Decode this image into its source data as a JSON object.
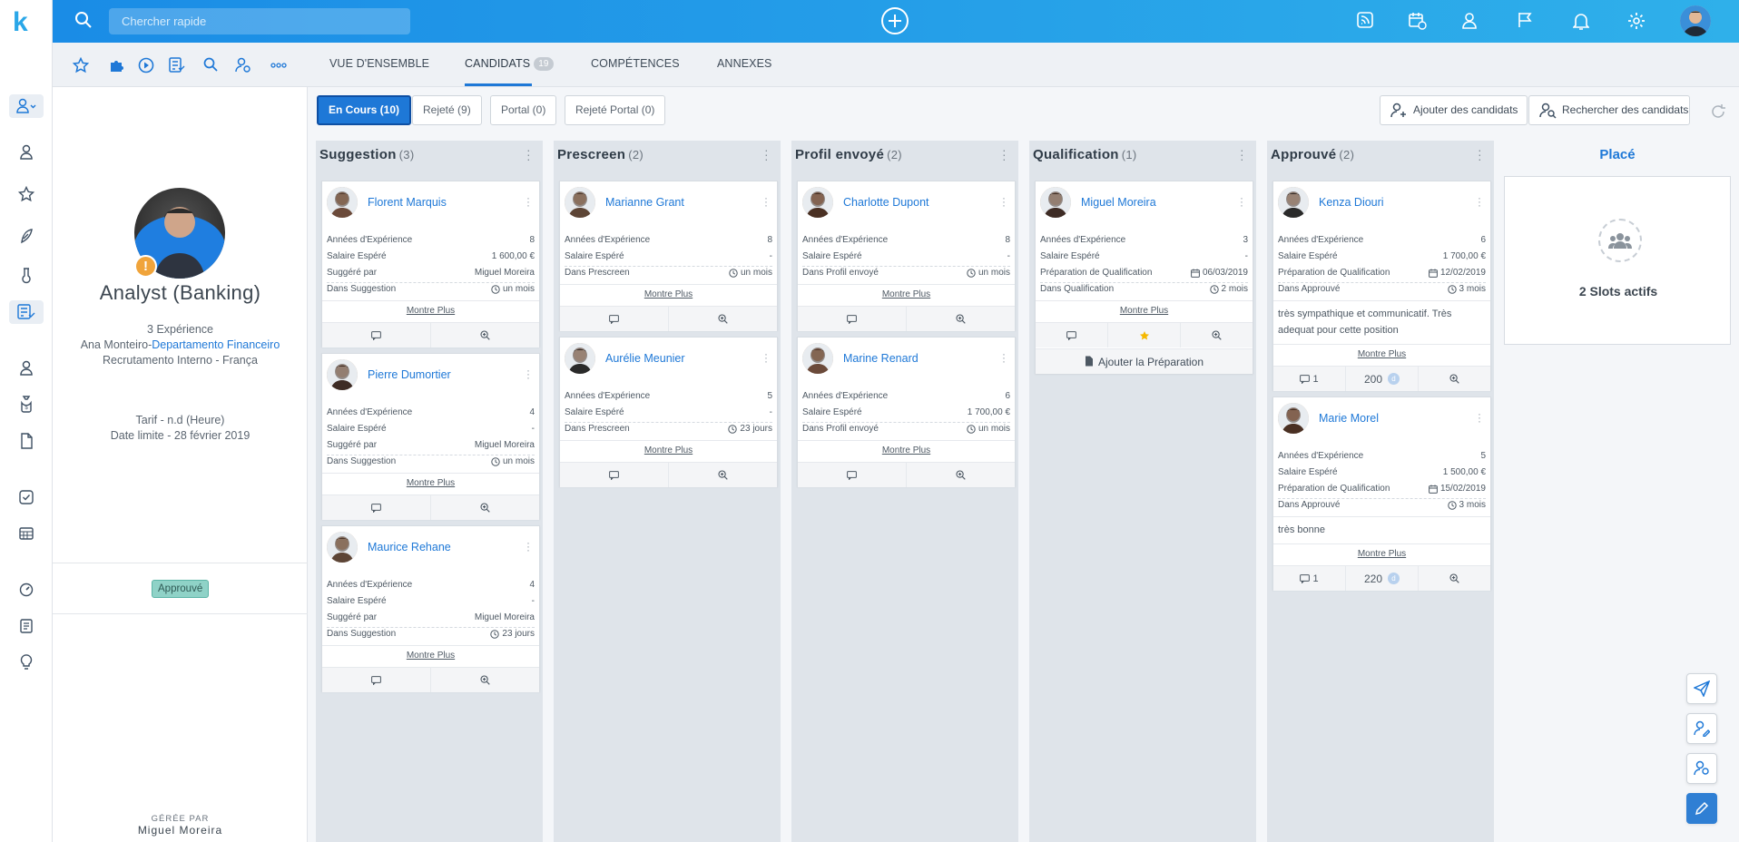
{
  "app": {
    "logo": "k"
  },
  "topbar": {
    "search_placeholder": "Chercher rapide"
  },
  "tabs": [
    {
      "label": "VUE D'ENSEMBLE"
    },
    {
      "label": "CANDIDATS",
      "badge": "19"
    },
    {
      "label": "COMPÉTENCES"
    },
    {
      "label": "ANNEXES"
    }
  ],
  "profile": {
    "title": "Analyst (Banking)",
    "experience": "3 Expérience",
    "contact": "Ana Monteiro-",
    "department": "Departamento Financeiro",
    "recruitment": "Recrutamento Interno - França",
    "rate_label": "Tarif -",
    "rate_value": "n.d (Heure)",
    "deadline_label": "Date limite -",
    "deadline_value": "28 février 2019",
    "status": "Approuvé",
    "managed_by_label": "GÉRÉE PAR",
    "managed_by_name": "Miguel Moreira"
  },
  "filters": [
    {
      "label": "En Cours (10)",
      "active": true
    },
    {
      "label": "Rejeté (9)"
    },
    {
      "label": "Portal (0)"
    },
    {
      "label": "Rejeté Portal (0)"
    }
  ],
  "actions": {
    "add": "Ajouter des candidats",
    "search": "Rechercher des candidats"
  },
  "common": {
    "more": "Montre Plus",
    "add_prep": "Ajouter la Préparation"
  },
  "columns": [
    {
      "title": "Suggestion",
      "count": "(3)",
      "cards": [
        {
          "name": "Florent Marquis",
          "rows": [
            [
              "Années d'Expérience",
              "8"
            ],
            [
              "Salaire Espéré",
              "1 600,00 €"
            ],
            [
              "Suggéré par",
              "Miguel Moreira"
            ],
            [
              "Dans Suggestion",
              "un mois"
            ]
          ]
        },
        {
          "name": "Pierre Dumortier",
          "rows": [
            [
              "Années d'Expérience",
              "4"
            ],
            [
              "Salaire Espéré",
              "-"
            ],
            [
              "Suggéré par",
              "Miguel Moreira"
            ],
            [
              "Dans Suggestion",
              "un mois"
            ]
          ]
        },
        {
          "name": "Maurice Rehane",
          "rows": [
            [
              "Années d'Expérience",
              "4"
            ],
            [
              "Salaire Espéré",
              "-"
            ],
            [
              "Suggéré par",
              "Miguel Moreira"
            ],
            [
              "Dans Suggestion",
              "23 jours"
            ]
          ]
        }
      ]
    },
    {
      "title": "Prescreen",
      "count": "(2)",
      "cards": [
        {
          "name": "Marianne Grant",
          "rows": [
            [
              "Années d'Expérience",
              "8"
            ],
            [
              "Salaire Espéré",
              "-"
            ],
            [
              "Dans Prescreen",
              "un mois"
            ]
          ]
        },
        {
          "name": "Aurélie Meunier",
          "rows": [
            [
              "Années d'Expérience",
              "5"
            ],
            [
              "Salaire Espéré",
              "-"
            ],
            [
              "Dans Prescreen",
              "23 jours"
            ]
          ]
        }
      ]
    },
    {
      "title": "Profil envoyé",
      "count": "(2)",
      "cards": [
        {
          "name": "Charlotte Dupont",
          "rows": [
            [
              "Années d'Expérience",
              "8"
            ],
            [
              "Salaire Espéré",
              "-"
            ],
            [
              "Dans Profil envoyé",
              "un mois"
            ]
          ]
        },
        {
          "name": "Marine Renard",
          "rows": [
            [
              "Années d'Expérience",
              "6"
            ],
            [
              "Salaire Espéré",
              "1 700,00 €"
            ],
            [
              "Dans Profil envoyé",
              "un mois"
            ]
          ]
        }
      ]
    },
    {
      "title": "Qualification",
      "count": "(1)",
      "cards": [
        {
          "name": "Miguel Moreira",
          "rows": [
            [
              "Années d'Expérience",
              "3"
            ],
            [
              "Salaire Espéré",
              "-"
            ],
            [
              "Préparation de Qualification",
              "06/03/2019"
            ],
            [
              "Dans Qualification",
              "2 mois"
            ]
          ]
        }
      ]
    },
    {
      "title": "Approuvé",
      "count": "(2)",
      "cards": [
        {
          "name": "Kenza Diouri",
          "rows": [
            [
              "Années d'Expérience",
              "6"
            ],
            [
              "Salaire Espéré",
              "1 700,00 €"
            ],
            [
              "Préparation de Qualification",
              "12/02/2019"
            ],
            [
              "Dans Approuvé",
              "3 mois"
            ]
          ],
          "note": "très sympathique et communicatif. Très adequat pour cette position",
          "comments": "1",
          "points": "200"
        },
        {
          "name": "Marie Morel",
          "rows": [
            [
              "Années d'Expérience",
              "5"
            ],
            [
              "Salaire Espéré",
              "1 500,00 €"
            ],
            [
              "Préparation de Qualification",
              "15/02/2019"
            ],
            [
              "Dans Approuvé",
              "3 mois"
            ]
          ],
          "note": "très bonne",
          "comments": "1",
          "points": "220"
        }
      ]
    }
  ],
  "placed": {
    "title": "Placé",
    "slots": "2 Slots actifs"
  },
  "colors": {
    "accent": "#1e78d7",
    "topbar_start": "#1a8ce6",
    "topbar_end": "#2fb0ea",
    "status_badge": "#8fd2c7",
    "star": "#f5b800"
  }
}
